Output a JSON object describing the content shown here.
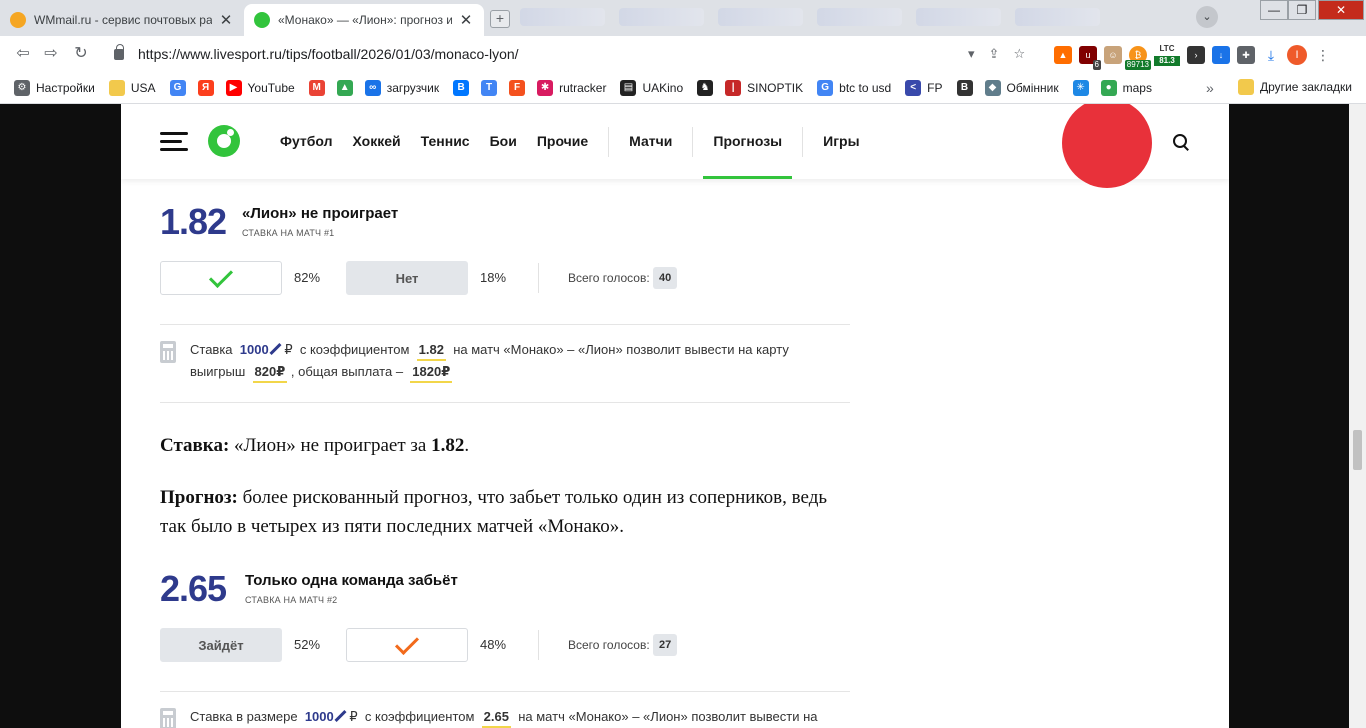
{
  "browser": {
    "tabs": [
      {
        "title": "WMmail.ru - сервис почтовых рассылок",
        "favicon_color": "#f5a623",
        "active": false
      },
      {
        "title": "«Монако» — «Лион»: прогноз и ставка",
        "favicon_color": "#32c43c",
        "active": true
      }
    ],
    "window": {
      "minimize": "—",
      "maximize": "❐",
      "close": "✕"
    },
    "url": "https://www.livesport.ru/tips/football/2026/01/03/monaco-lyon/",
    "extensions": {
      "badge_ublock": "6",
      "badge_btc": "89713",
      "ltc_label": "LTC",
      "ltc_value": "81.3",
      "avatar_letter": "I"
    },
    "bookmarks": [
      {
        "label": "Настройки",
        "icon": "gear-icon",
        "color": "#5f6368"
      },
      {
        "label": "USA",
        "icon": "folder-icon",
        "color": "#f2c94c"
      },
      {
        "label": "",
        "icon": "google-icon",
        "color": "#4285f4"
      },
      {
        "label": "",
        "icon": "yandex-icon",
        "color": "#fc3f1d"
      },
      {
        "label": "YouTube",
        "icon": "youtube-icon",
        "color": "#ff0000"
      },
      {
        "label": "",
        "icon": "gmail-icon",
        "color": "#ea4335"
      },
      {
        "label": "",
        "icon": "drive-icon",
        "color": "#34a853"
      },
      {
        "label": "загрузчик",
        "icon": "loop-icon",
        "color": "#1a73e8"
      },
      {
        "label": "",
        "icon": "vk-icon",
        "color": "#0077ff"
      },
      {
        "label": "",
        "icon": "translate-icon",
        "color": "#4285f4"
      },
      {
        "label": "",
        "icon": "f-icon",
        "color": "#f4511e"
      },
      {
        "label": "rutracker",
        "icon": "rutracker-icon",
        "color": "#d81b60"
      },
      {
        "label": "UAKino",
        "icon": "uakino-icon",
        "color": "#222222"
      },
      {
        "label": "",
        "icon": "chess-icon",
        "color": "#222222"
      },
      {
        "label": "SINOPTIK",
        "icon": "thermometer-icon",
        "color": "#c62828"
      },
      {
        "label": "btc to usd",
        "icon": "google-icon",
        "color": "#4285f4"
      },
      {
        "label": "FP",
        "icon": "fp-icon",
        "color": "#3949ab"
      },
      {
        "label": "",
        "icon": "bc-icon",
        "color": "#333333"
      },
      {
        "label": "Обмінник",
        "icon": "exchange-icon",
        "color": "#607d8b"
      },
      {
        "label": "",
        "icon": "star-icon",
        "color": "#1e88e5"
      },
      {
        "label": "maps",
        "icon": "maps-icon",
        "color": "#34a853"
      }
    ],
    "bookmarks_more": "»",
    "other_bookmarks": "Другие закладки"
  },
  "site": {
    "nav": [
      "Футбол",
      "Хоккей",
      "Теннис",
      "Бои",
      "Прочие",
      "Матчи",
      "Прогнозы",
      "Игры"
    ],
    "active_nav": "Прогнозы"
  },
  "bet1": {
    "odds": "1.82",
    "title": "«Лион» не проиграет",
    "subtitle": "СТАВКА НА МАТЧ #1",
    "yes_pct": "82%",
    "no_label": "Нет",
    "no_pct": "18%",
    "votes_label": "Всего голосов:",
    "votes_count": "40"
  },
  "calc1": {
    "t1": "Ставка",
    "stake": "1000",
    "currency": "₽",
    "t2": "с коэффициентом",
    "odds": "1.82",
    "t3": "на матч «Монако» – «Лион»  позволит вывести на карту выигрыш",
    "win": "820₽",
    "t4": ", общая выплата –",
    "payout": "1820₽"
  },
  "article": {
    "p1_label": "Ставка:",
    "p1_text": "«Лион» не проиграет за",
    "p1_odds": "1.82",
    "p1_end": ".",
    "p2_label": "Прогноз:",
    "p2_text": "более рискованный прогноз, что забьет только один из соперников, ведь так было в четырех из пяти последних матчей «Монако»."
  },
  "bet2": {
    "odds": "2.65",
    "title": "Только одна команда забьёт",
    "subtitle": "СТАВКА НА МАТЧ #2",
    "yes_label": "Зайдёт",
    "yes_pct": "52%",
    "no_pct": "48%",
    "votes_label": "Всего голосов:",
    "votes_count": "27"
  },
  "calc2": {
    "t1": "Ставка в размере",
    "stake": "1000",
    "currency": "₽",
    "t2": "с коэффициентом",
    "odds": "2.65",
    "t3": "на матч «Монако» – «Лион»  позволит вывести на"
  }
}
